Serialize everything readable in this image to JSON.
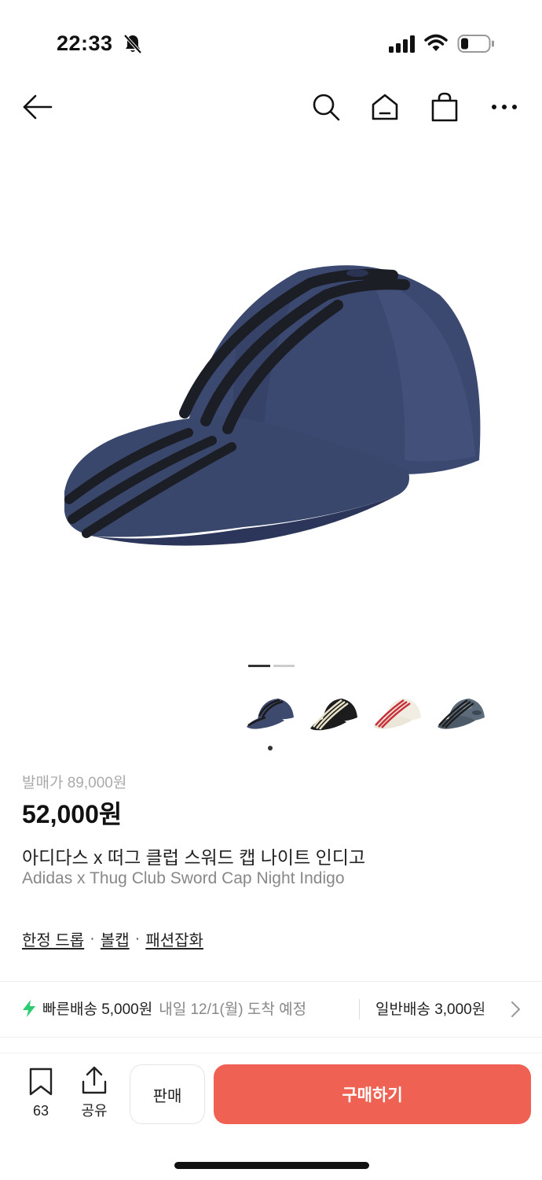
{
  "status_bar": {
    "time": "22:33",
    "icons": [
      "bell-off-icon",
      "signal-icon",
      "wifi-icon",
      "battery-icon"
    ]
  },
  "nav": {
    "icons": [
      "back-arrow-icon",
      "search-icon",
      "home-icon",
      "shopping-bag-icon",
      "more-icon"
    ]
  },
  "gallery": {
    "main_image": "navy cap with three black leather stripes",
    "page_count": 2,
    "current_page": 1,
    "thumbnails": [
      {
        "color": "#3d4a6e",
        "stripe": "#1a1a1a",
        "name": "night-indigo"
      },
      {
        "color": "#1c1c1c",
        "stripe": "#e8e2c8",
        "name": "black"
      },
      {
        "color": "#f1ede2",
        "stripe": "#c9303a",
        "name": "cream-red"
      },
      {
        "color": "#5c6b7a",
        "stripe": "#222",
        "name": "camo"
      }
    ],
    "selected_thumbnail": 0
  },
  "product": {
    "release_price": "발매가 89,000원",
    "price": "52,000원",
    "name_ko": "아디다스 x 떠그 클럽 스워드 캡 나이트 인디고",
    "name_en": "Adidas x Thug Club Sword Cap Night Indigo",
    "tags": [
      "한정 드롭",
      "볼캡",
      "패션잡화"
    ],
    "tag_separator": "·"
  },
  "shipping": {
    "fast_label": "빠른배송 5,000원",
    "fast_date": "내일 12/1(월) 도착 예정",
    "normal_label": "일반배송 3,000원",
    "accent_color": "#2ecc71"
  },
  "bottom_bar": {
    "wishlist_count": "63",
    "share_label": "공유",
    "sell_label": "판매",
    "buy_label": "구매하기",
    "buy_color": "#ef6253"
  }
}
